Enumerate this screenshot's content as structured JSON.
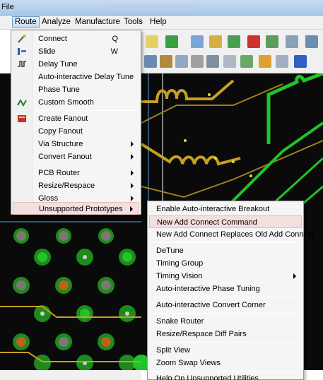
{
  "titlebar": {
    "file_label": "File"
  },
  "menubar": {
    "items": [
      "Route",
      "Analyze",
      "Manufacture",
      "Tools",
      "Help"
    ]
  },
  "route_menu": {
    "items": [
      {
        "label": "Connect",
        "shortcut": "Q"
      },
      {
        "label": "Slide",
        "shortcut": "W"
      },
      {
        "label": "Delay Tune"
      },
      {
        "label": "Auto-interactive Delay Tune"
      },
      {
        "label": "Phase Tune"
      },
      {
        "label": "Custom Smooth"
      },
      {
        "label": "Create Fanout"
      },
      {
        "label": "Copy Fanout"
      },
      {
        "label": "Via Structure"
      },
      {
        "label": "Convert Fanout"
      },
      {
        "label": "PCB Router"
      },
      {
        "label": "Resize/Respace"
      },
      {
        "label": "Gloss"
      },
      {
        "label": "Unsupported Prototypes"
      }
    ]
  },
  "submenu": {
    "items": [
      {
        "label": "Enable Auto-interactive Breakout"
      },
      {
        "label": "New Add Connect Command"
      },
      {
        "label": "New Add Connect Replaces Old Add Connect"
      },
      {
        "label": "DeTune"
      },
      {
        "label": "Timing Group"
      },
      {
        "label": "Timing Vision"
      },
      {
        "label": "Auto-interactive Phase Tuning"
      },
      {
        "label": "Auto-interactive Convert Corner"
      },
      {
        "label": "Snake Router"
      },
      {
        "label": "Resize/Respace Diff Pairs"
      },
      {
        "label": "Split View"
      },
      {
        "label": "Zoom Swap Views"
      },
      {
        "label": "Help On Unsupported Utilities"
      }
    ]
  },
  "colors": {
    "menu_highlight": "#f5dede",
    "active_menu": "#c9dcf2",
    "trace_green": "#22c22a",
    "trace_yellow": "#c8a020"
  }
}
